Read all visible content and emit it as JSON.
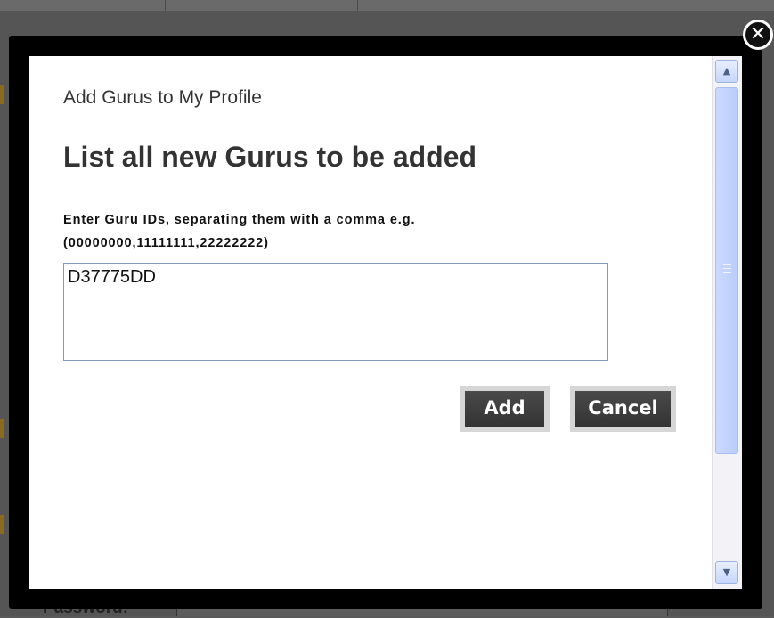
{
  "dialog": {
    "header_title": "Add Gurus to My Profile",
    "section_title": "List all new Gurus to be added",
    "instructions_line1": "Enter Guru IDs, separating them with a comma e.g.",
    "instructions_line2": "(00000000,11111111,22222222)",
    "guru_ids_value": "D37775DD",
    "add_label": "Add",
    "cancel_label": "Cancel",
    "close_symbol": "✕"
  },
  "background": {
    "password_label": "Password:"
  },
  "scrollbar": {
    "up_arrow": "▲",
    "down_arrow": "▼"
  }
}
